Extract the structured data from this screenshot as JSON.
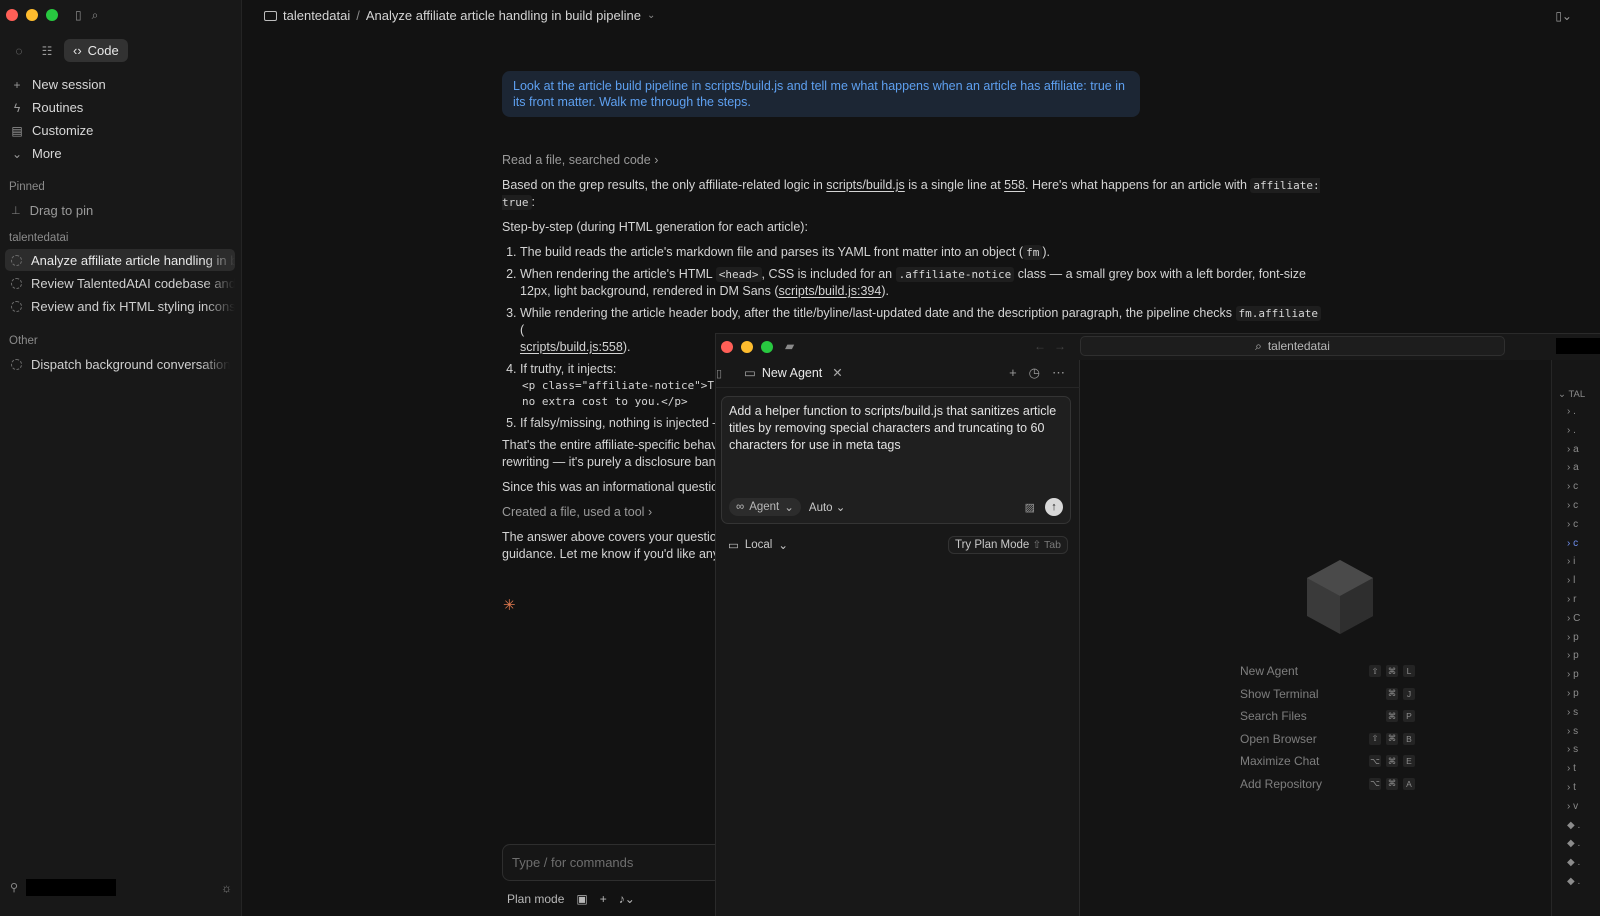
{
  "sidebar": {
    "mode_label": "Code",
    "nav": [
      {
        "icon": "plus-icon",
        "label": "New session"
      },
      {
        "icon": "routines-icon",
        "label": "Routines"
      },
      {
        "icon": "customize-icon",
        "label": "Customize"
      },
      {
        "icon": "chevron-down-icon",
        "label": "More"
      }
    ],
    "pinned_label": "Pinned",
    "drag_to_pin": "Drag to pin",
    "project_label": "talentedatai",
    "sessions": [
      "Analyze affiliate article handling in build pipeline",
      "Review TalentedAtAI codebase and build",
      "Review and fix HTML styling inconsistencies"
    ],
    "other_label": "Other",
    "other_sessions": [
      "Dispatch background conversation"
    ]
  },
  "header": {
    "project": "talentedatai",
    "separator": "/",
    "title": "Analyze affiliate article handling in build pipeline"
  },
  "chat": {
    "user_message": "Look at the article build pipeline in scripts/build.js and tell me what happens when an article has affiliate: true in its front matter. Walk me through the steps.",
    "tool_summary_1": "Read a file, searched code",
    "para1_a": "Based on the grep results, the only affiliate-related logic in ",
    "para1_link": "scripts/build.js",
    "para1_b": " is a single line at ",
    "para1_line": "558",
    "para1_c": ". Here's what happens for an article with ",
    "para1_code": "affiliate: true",
    "para1_d": ":",
    "steps_heading": "Step-by-step (during HTML generation for each article):",
    "step1_a": "The build reads the article's markdown file and parses its YAML front matter into an object (",
    "step1_code": "fm",
    "step1_b": ").",
    "step2_a": "When rendering the article's HTML ",
    "step2_code1": "<head>",
    "step2_b": ", CSS is included for an ",
    "step2_code2": ".affiliate-notice",
    "step2_c": " class — a small grey box with a left border, font-size 12px, light background, rendered in DM Sans (",
    "step2_link": "scripts/build.js:394",
    "step2_d": ").",
    "step3_a": "While rendering the article header body, after the title/byline/last-updated date and the description paragraph, the pipeline checks ",
    "step3_code": "fm.affiliate",
    "step3_b": " (",
    "step3_link": "scripts/build.js:558",
    "step3_c": ").",
    "step4_a": "If truthy, it injects:",
    "step4_code_line1": "<p class=\"affiliate-notice\">Thi",
    "step4_code_line2": "no extra cost to you.</p>",
    "step5_a": "If falsy/missing, nothing is injected —",
    "para_after_1": "That's the entire affiliate-specific behav",
    "para_after_1b": "rewriting — it's purely a disclosure bann",
    "para_after_2": "Since this was an informational question",
    "tool_summary_2": "Created a file, used a tool",
    "para_after_3": "The answer above covers your question",
    "para_after_3b": "guidance. Let me know if you'd like any c",
    "input_placeholder": "Type / for commands",
    "plan_mode_label": "Plan mode"
  },
  "overlay": {
    "search_label": "talentedatai",
    "tab_label": "New Agent",
    "composer_text": "Add a helper function to scripts/build.js that sanitizes article titles by removing special characters and truncating to 60 characters for use in meta tags",
    "agent_pill": "Agent",
    "auto_label": "Auto",
    "local_label": "Local",
    "plan_button": "Try Plan Mode",
    "plan_key": "⇧ Tab",
    "shortcuts": [
      {
        "label": "New Agent",
        "keys": [
          "⇧",
          "⌘",
          "L"
        ]
      },
      {
        "label": "Show Terminal",
        "keys": [
          "⌘",
          "J"
        ]
      },
      {
        "label": "Search Files",
        "keys": [
          "⌘",
          "P"
        ]
      },
      {
        "label": "Open Browser",
        "keys": [
          "⇧",
          "⌘",
          "B"
        ]
      },
      {
        "label": "Maximize Chat",
        "keys": [
          "⌥",
          "⌘",
          "E"
        ]
      },
      {
        "label": "Add Repository",
        "keys": [
          "⌥",
          "⌘",
          "A"
        ]
      }
    ],
    "tree_head": "TAL",
    "tree_rows": [
      ".",
      ".",
      "a",
      "a",
      "c",
      "c",
      "c",
      "c",
      "i",
      "l",
      "r",
      "C",
      "p",
      "p",
      "p",
      "p",
      "s",
      "s",
      "s",
      "t",
      "t",
      "v",
      ".",
      ".",
      ".",
      "."
    ]
  }
}
